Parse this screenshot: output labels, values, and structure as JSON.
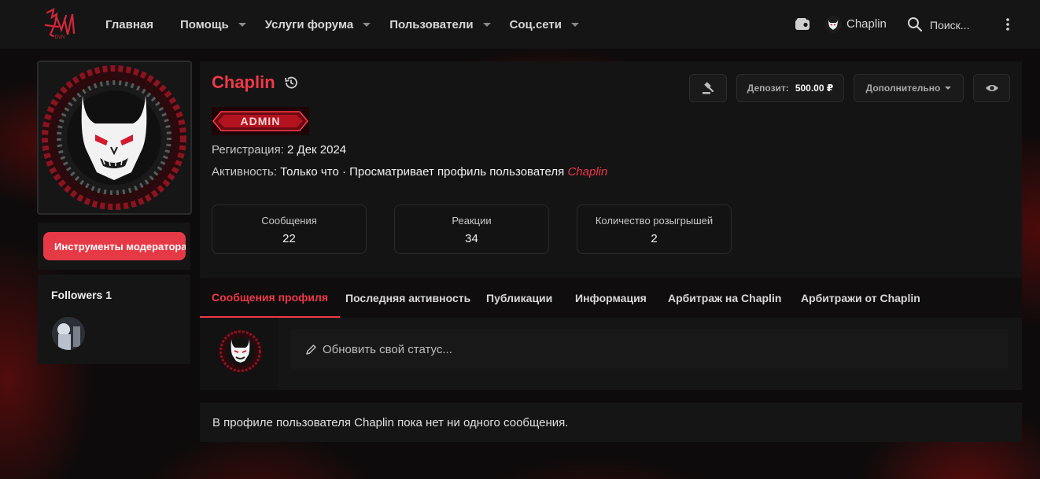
{
  "nav": {
    "logo_text": "DVN",
    "items": [
      {
        "label": "Главная",
        "has_dropdown": false
      },
      {
        "label": "Помощь",
        "has_dropdown": true
      },
      {
        "label": "Услуги форума",
        "has_dropdown": true
      },
      {
        "label": "Пользователи",
        "has_dropdown": true
      },
      {
        "label": "Соц.сети",
        "has_dropdown": true
      }
    ],
    "user": "Chaplin",
    "search_label": "Поиск..."
  },
  "sidebar": {
    "moderator_button": "Инструменты модератора",
    "followers_title": "Followers 1"
  },
  "profile": {
    "username": "Chaplin",
    "badge": "ADMIN",
    "registration_label": "Регистрация:",
    "registration_value": "2 Дек 2024",
    "activity_label": "Активность:",
    "activity_value": "Только что · Просматривает профиль пользователя",
    "activity_name": "Chaplin",
    "stats": [
      {
        "label": "Сообщения",
        "value": "22"
      },
      {
        "label": "Реакции",
        "value": "34"
      },
      {
        "label": "Количество розыгрышей",
        "value": "2"
      }
    ],
    "deposit_label": "Депозит:",
    "deposit_value": "500.00 ₽",
    "more_label": "Дополнительно"
  },
  "tabs": [
    {
      "label": "Сообщения профиля",
      "active": true
    },
    {
      "label": "Последняя активность",
      "active": false
    },
    {
      "label": "Публикации",
      "active": false
    },
    {
      "label": "Информация",
      "active": false
    },
    {
      "label": "Арбитраж на Chaplin",
      "active": false
    },
    {
      "label": "Арбитражи от Chaplin",
      "active": false
    }
  ],
  "status": {
    "placeholder": "Обновить свой статус..."
  },
  "empty_message": "В профиле пользователя Chaplin пока нет ни одного сообщения.",
  "colors": {
    "accent": "#f0384a",
    "button_red": "#e63946",
    "panel": "#151515"
  }
}
